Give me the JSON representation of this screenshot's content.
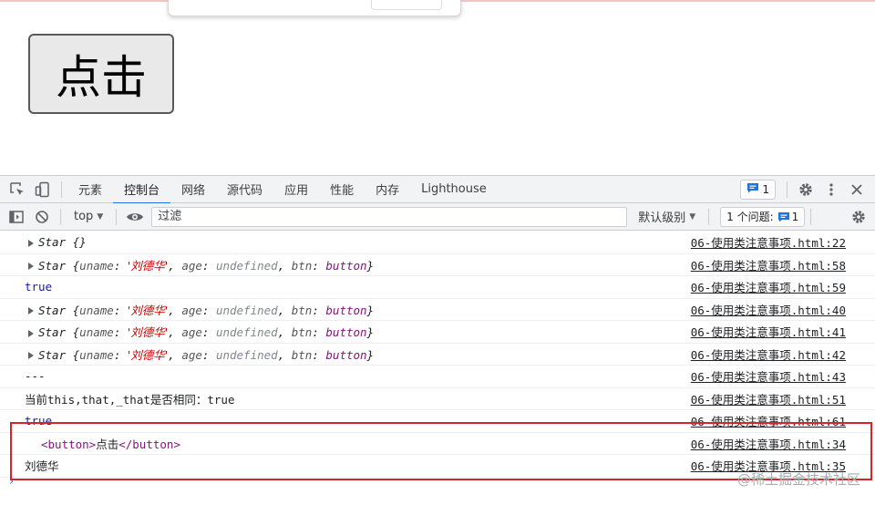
{
  "page": {
    "button_label": "点击"
  },
  "devtools": {
    "tabs": [
      "元素",
      "控制台",
      "网络",
      "源代码",
      "应用",
      "性能",
      "内存",
      "Lighthouse"
    ],
    "active_tab": "控制台",
    "message_count": "1"
  },
  "toolbar": {
    "context": "top",
    "filter_placeholder": "过滤",
    "levels_label": "默认级别",
    "issues_label": "1 个问题:",
    "issues_count": "1"
  },
  "console": {
    "rows": [
      {
        "src": "06-使用类注意事项.html:22"
      },
      {
        "src": "06-使用类注意事项.html:58"
      },
      {
        "text": "true",
        "src": "06-使用类注意事项.html:59"
      },
      {
        "src": "06-使用类注意事项.html:40"
      },
      {
        "src": "06-使用类注意事项.html:41"
      },
      {
        "src": "06-使用类注意事项.html:42"
      },
      {
        "text": "---",
        "src": "06-使用类注意事项.html:43"
      },
      {
        "text": "当前this,that,_that是否相同：true",
        "src": "06-使用类注意事项.html:51"
      },
      {
        "text": "true",
        "src": "06-使用类注意事项.html:61"
      },
      {
        "text_open": "<button>",
        "text_mid": "点击",
        "text_close": "</button>",
        "src": "06-使用类注意事项.html:34"
      },
      {
        "text": "刘德华",
        "src": "06-使用类注意事项.html:35"
      }
    ],
    "star": {
      "name": "Star",
      "empty": "{}",
      "uname_key": "uname",
      "uname_val": "'刘德华'",
      "age_key": "age",
      "age_val": "undefined",
      "btn_key": "btn",
      "btn_val": "button"
    }
  },
  "watermark": "@稀土掘金技术社区",
  "colors": {
    "accent": "#1a73e8",
    "highlight": "#d6232c"
  }
}
